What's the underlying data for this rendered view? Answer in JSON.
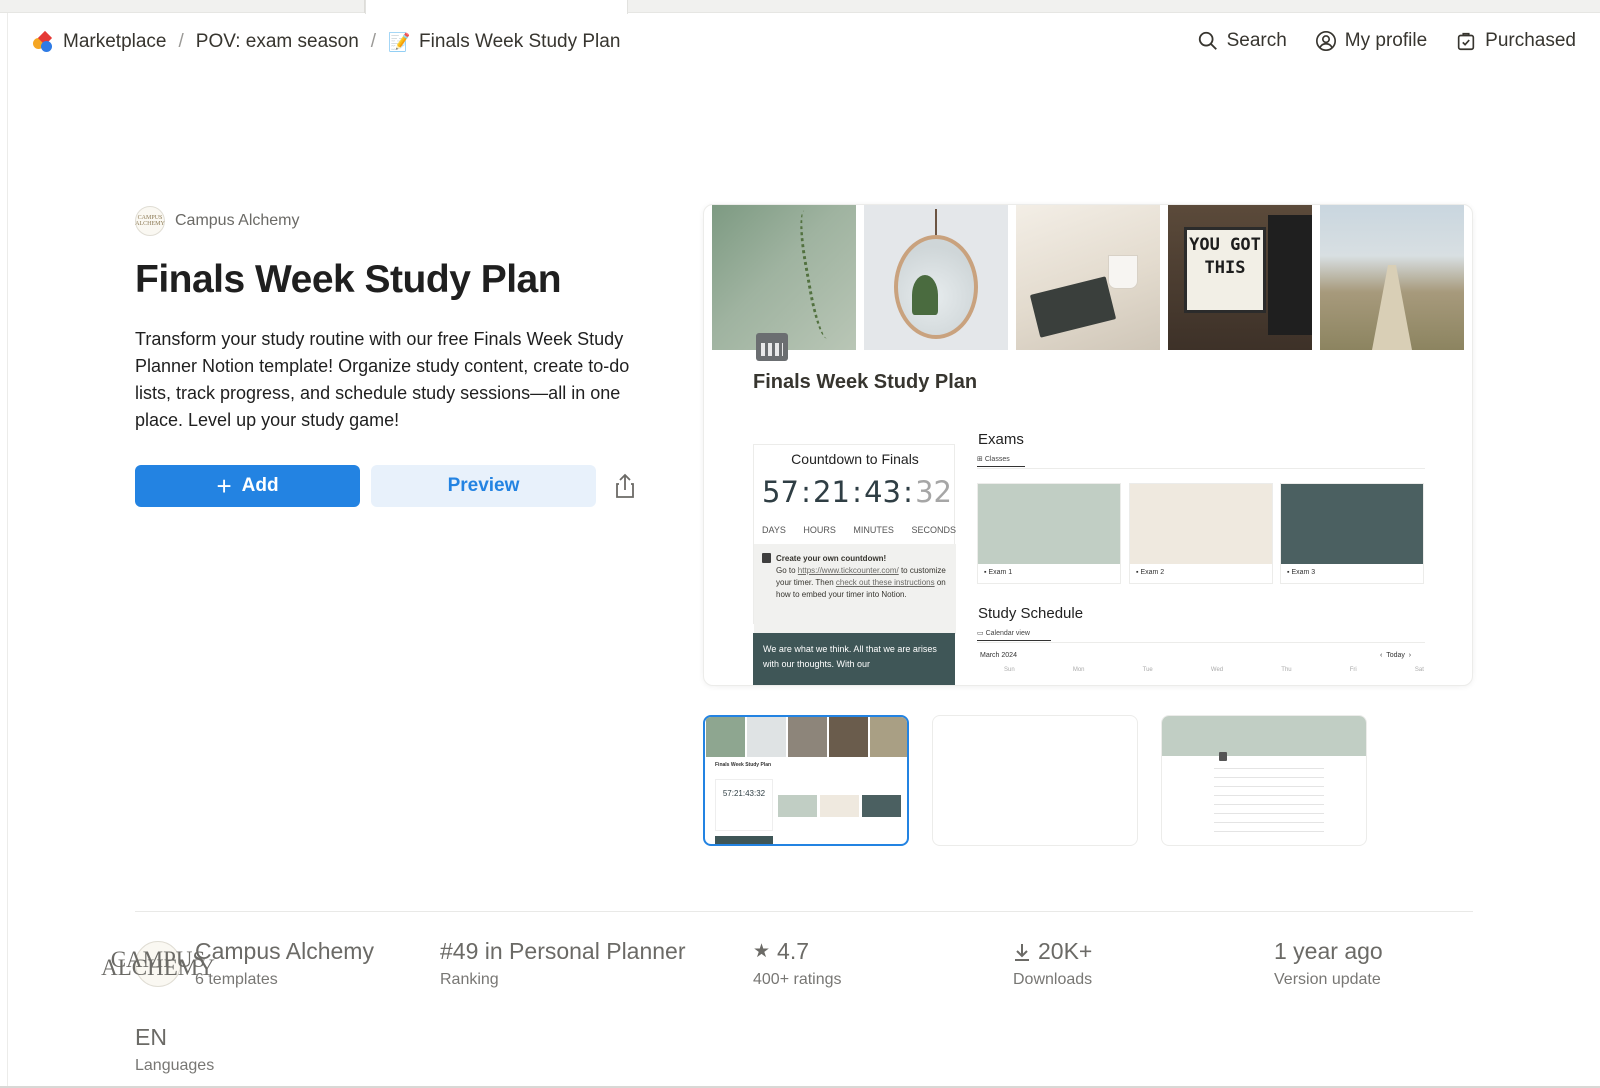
{
  "breadcrumb": {
    "items": [
      {
        "label": "Marketplace",
        "icon": "marketplace-logo-icon"
      },
      {
        "label": "POV: exam season"
      },
      {
        "label": "Finals Week Study Plan",
        "icon": "memo-icon"
      }
    ],
    "separator": "/"
  },
  "topnav": {
    "search": "Search",
    "profile": "My profile",
    "purchased": "Purchased"
  },
  "creator": {
    "name": "Campus Alchemy",
    "seal_text": "CAMPUS ALCHEMY"
  },
  "product": {
    "title": "Finals Week Study Plan",
    "description": "Transform your study routine with our free Finals Week Study Planner Notion template! Organize study content, create to-do lists, track progress, and schedule study sessions—all in one place. Level up your study game!"
  },
  "actions": {
    "add_label": "Add",
    "preview_label": "Preview"
  },
  "preview": {
    "page_title": "Finals Week Study Plan",
    "lightbox_text": "YOU GOT THIS",
    "countdown": {
      "title": "Countdown to Finals",
      "days": "57",
      "hours": "21",
      "minutes": "43",
      "seconds": "32",
      "units": [
        "DAYS",
        "HOURS",
        "MINUTES",
        "SECONDS"
      ],
      "note_title": "Create your own countdown!",
      "note_pre": "Go to ",
      "note_link": "https://www.tickcounter.com/",
      "note_mid": " to customize your timer. Then ",
      "note_link2": "check out these instructions",
      "note_post": " on how to embed your timer into Notion."
    },
    "quote": "We are what we think. All that we are arises with our thoughts. With our",
    "exams": {
      "heading": "Exams",
      "view_tab": "Classes",
      "cards": [
        {
          "label": "Exam 1",
          "color": "#c1cec4"
        },
        {
          "label": "Exam 2",
          "color": "#efe9df"
        },
        {
          "label": "Exam 3",
          "color": "#4b6061"
        }
      ]
    },
    "schedule": {
      "heading": "Study Schedule",
      "view_tab": "Calendar view",
      "month": "March 2024",
      "today": "Today",
      "days": [
        "Sun",
        "Mon",
        "Tue",
        "Wed",
        "Thu",
        "Fri",
        "Sat"
      ]
    }
  },
  "thumbnails": {
    "t1_countdown": "57:21:43:32"
  },
  "stats": {
    "creator_name": "Campus Alchemy",
    "creator_templates": "6 templates",
    "ranking_value": "#49 in Personal Planner",
    "ranking_label": "Ranking",
    "rating_value": "4.7",
    "rating_label": "400+ ratings",
    "downloads_value": "20K+",
    "downloads_label": "Downloads",
    "update_value": "1 year ago",
    "update_label": "Version update",
    "language_value": "EN",
    "language_label": "Languages"
  },
  "colors": {
    "accent": "#2383e2",
    "accent_light": "#e8f1fb",
    "text": "#37352f",
    "muted": "#787774"
  }
}
